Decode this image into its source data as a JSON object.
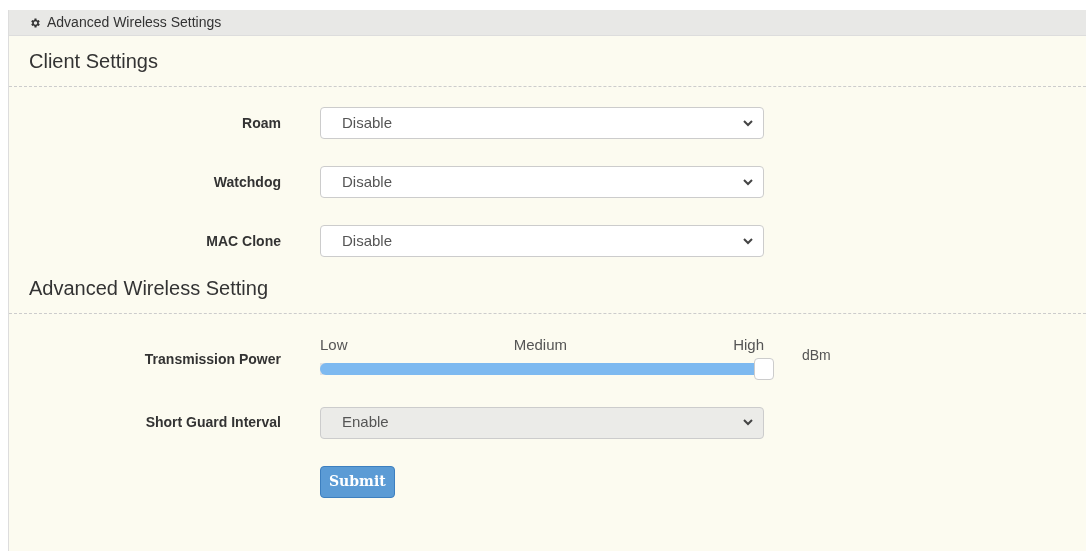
{
  "panel": {
    "title": "Advanced Wireless Settings"
  },
  "sections": [
    {
      "title": "Client Settings",
      "rows": [
        {
          "kind": "select",
          "label": "Roam",
          "value": "Disable",
          "disabled": false
        },
        {
          "kind": "select",
          "label": "Watchdog",
          "value": "Disable",
          "disabled": false
        },
        {
          "kind": "select",
          "label": "MAC Clone",
          "value": "Disable",
          "disabled": false
        }
      ]
    },
    {
      "title": "Advanced Wireless Setting",
      "rows": [
        {
          "kind": "slider",
          "label": "Transmission Power",
          "ticks": [
            "Low",
            "Medium",
            "High"
          ],
          "level": 1,
          "unit": "dBm"
        },
        {
          "kind": "select",
          "label": "Short Guard Interval",
          "value": "Enable",
          "disabled": true
        }
      ]
    }
  ],
  "submit": "Submit"
}
